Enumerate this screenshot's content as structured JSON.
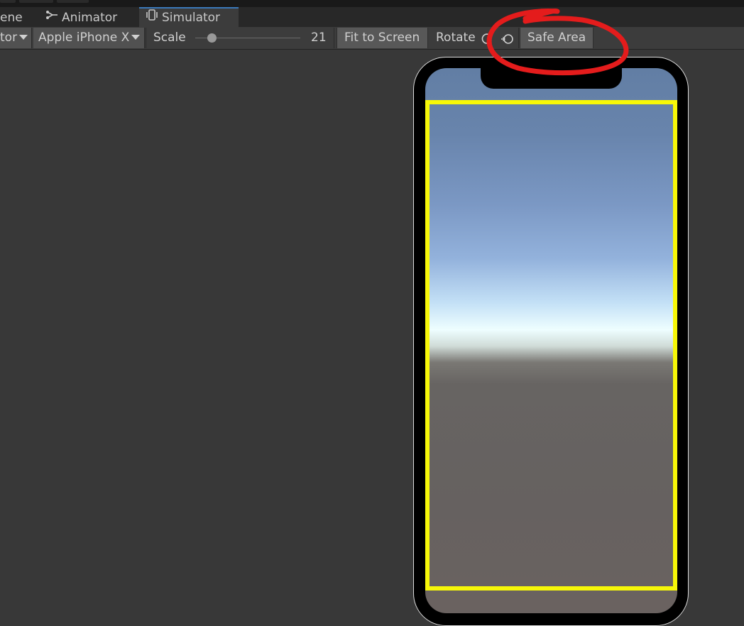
{
  "tabs": [
    {
      "label": "ene",
      "icon": "scene-icon"
    },
    {
      "label": "Animator",
      "icon": "animator-icon"
    },
    {
      "label": "Simulator",
      "icon": "simulator-device-icon"
    }
  ],
  "toolbar": {
    "view_dropdown": "tor",
    "device_dropdown": "Apple iPhone X",
    "scale_label": "Scale",
    "scale_value": "21",
    "fit_to_screen": "Fit to Screen",
    "rotate_label": "Rotate",
    "safe_area": "Safe Area"
  },
  "colors": {
    "safe_area_outline": "#f7f708",
    "annotation": "#e41c1c",
    "tab_active_accent": "#3a79bb"
  },
  "annotation": {
    "shape": "hand-drawn red circle",
    "target": "safe-area-button"
  }
}
